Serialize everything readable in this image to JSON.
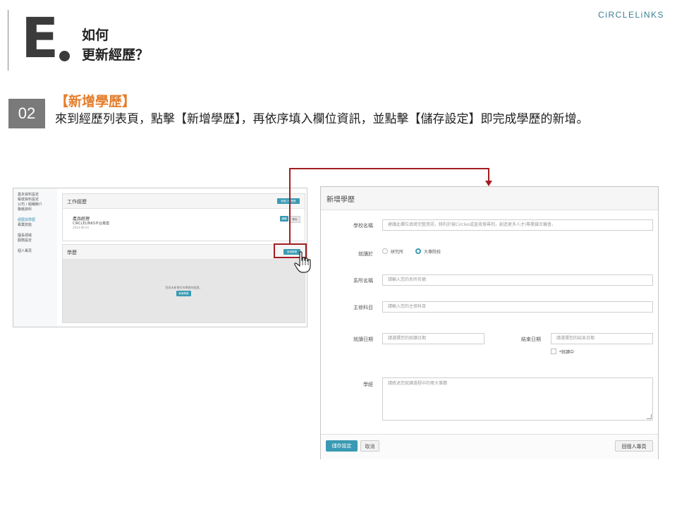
{
  "header": {
    "letter": "E",
    "title_line1": "如何",
    "title_line2": "更新經歷？",
    "brand": "CiRCLELiNKS"
  },
  "step": {
    "number": "02",
    "heading": "【新增學歷】",
    "description": "來到經歷列表頁，點擊【新增學歷】，再依序填入欄位資訊，並點擊【儲存設定】即完成學歷的新增。"
  },
  "left_screenshot": {
    "sidebar": [
      {
        "label": "基本資料設定",
        "active": false
      },
      {
        "label": "帳號資料設定",
        "active": false
      },
      {
        "label": "公司 / 組織簡介",
        "active": false
      },
      {
        "label": "聯絡資料",
        "active": false
      },
      {
        "label": "經歷與學歷",
        "active": true
      },
      {
        "label": "專業技能",
        "active": false
      },
      {
        "label": "擅長領域",
        "active": false
      },
      {
        "label": "服務設定",
        "active": false
      },
      {
        "label": "個人專頁",
        "active": false
      }
    ],
    "work_panel": {
      "title": "工作經歷",
      "add_button": "新增工作經歷",
      "entry_title": "產品經理",
      "entry_company": "CIRCLELINKS平台專案",
      "entry_date": "2014-06-01",
      "edit_button": "編輯",
      "delete_button": "刪除"
    },
    "edu_panel": {
      "title": "學歷",
      "add_button": "新增學歷",
      "empty_text": "您尚未新增任何學歷的經歷。",
      "empty_add_button": "新增學歷"
    }
  },
  "dialog": {
    "title": "新增學歷",
    "fields": {
      "school_label": "學校名稱",
      "school_placeholder": "建議此欄位填寫完整資訊，將利於被Circles或直接搜尋到，創造更多人才/專業媒合機會。",
      "level_label": "就讀於",
      "level_options": [
        "研究所",
        "大專院校"
      ],
      "level_selected": "大專院校",
      "dept_label": "系所名稱",
      "dept_placeholder": "請輸入您的系所名稱",
      "major_label": "主修科目",
      "major_placeholder": "請輸入您的主修科目",
      "start_label": "就讀日期",
      "start_placeholder": "請選擇您的就讀日期",
      "end_label": "結束日期",
      "end_placeholder": "請選擇您的結束日期",
      "studying_label": "*就讀中",
      "note_label": "學經",
      "note_placeholder": "請敘述您就讀過程中的偉大事蹟"
    },
    "footer": {
      "save": "儲存設定",
      "cancel": "取消",
      "profile": "回個人專頁"
    }
  },
  "colors": {
    "accent": "#3a9ab3",
    "highlight": "#a31d22",
    "step_heading": "#e57e2d"
  }
}
